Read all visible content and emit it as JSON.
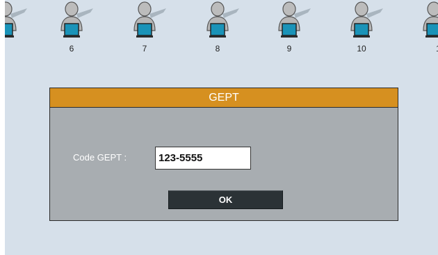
{
  "workstations": [
    {
      "label": ""
    },
    {
      "label": "6"
    },
    {
      "label": "7"
    },
    {
      "label": "8"
    },
    {
      "label": "9"
    },
    {
      "label": "10"
    },
    {
      "label": "1"
    }
  ],
  "dialog": {
    "title": "GEPT",
    "field_label": "Code GEPT :",
    "field_value": "123-5555",
    "ok_label": "OK"
  },
  "colors": {
    "workspace_bg": "#d6e0ea",
    "dialog_bg": "#a8adb1",
    "title_bar": "#d69020",
    "button_bg": "#2b3236",
    "monitor_screen": "#1a93b8"
  },
  "icons": {
    "workstation": "person-at-computer-icon"
  }
}
